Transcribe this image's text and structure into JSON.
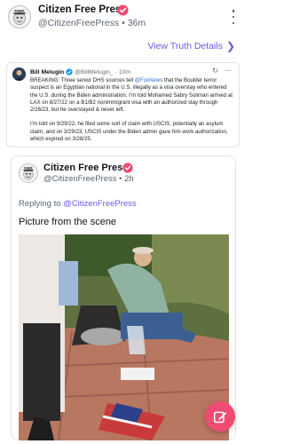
{
  "header": {
    "account_name": "Citizen Free Press",
    "handle_time": "@CitizenFreePress • 36m",
    "avatar_icon": "citizen-free-press-logo",
    "menu_icon": "kebab-menu-icon"
  },
  "view_link": {
    "label": "View Truth Details",
    "icon": "chevron-right-icon"
  },
  "quoted_post": {
    "author_name": "Bill Melugin",
    "author_handle": "@BillMelugin_",
    "time": "· 10m",
    "paragraph_1_before": "BREAKING: Three senior DHS sources tell ",
    "mention": "@FoxNews",
    "paragraph_1_after": " that the Boulder terror suspect is an Egyptian national in the U.S. illegally as a visa overstay who entered the U.S. during the Biden administration. I’m told Mohamed Sabry Soliman arrived at LAX on 8/27/22 on a B1/B2 nonimmigrant visa with an authorized stay through 2/26/23, but he overstayed & never left.",
    "paragraph_2": "I’m told on 9/29/22, he filed some sort of claim with USCIS, potentially an asylum claim, and on 3/29/23, USCIS under the Biden admin gave him work authorization, which expired on 3/28/25."
  },
  "reply_post": {
    "account_name": "Citizen Free Press",
    "handle_time": "@CitizenFreePress • 2h",
    "replying_prefix": "Replying to ",
    "replying_handle": "@CitizenFreePress",
    "caption": "Picture from the scene",
    "photo_alt": "scene-photo"
  },
  "fab": {
    "icon": "compose-icon",
    "color": "#ef4c73"
  },
  "colors": {
    "accent": "#6a5ae0",
    "verified": "#ef4c73",
    "text": "#0f1419",
    "muted": "#5b6670"
  }
}
